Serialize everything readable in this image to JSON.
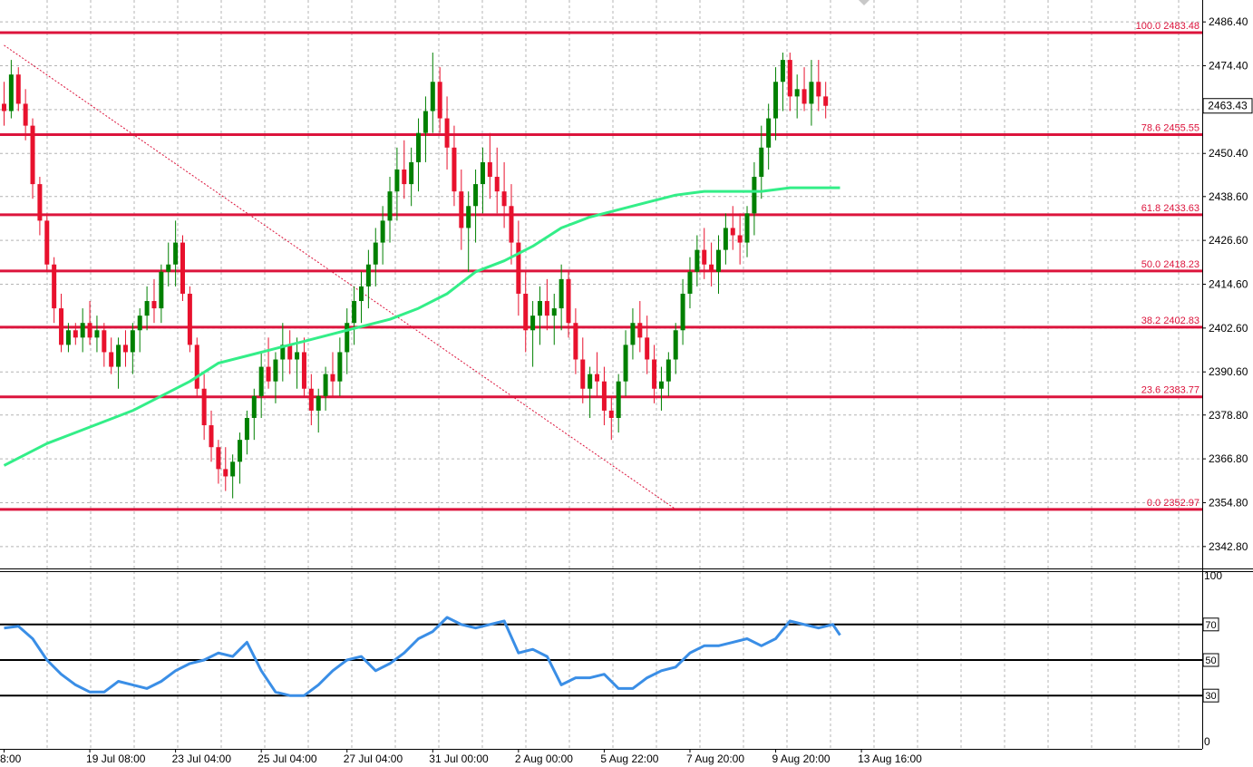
{
  "chart_data": [
    {
      "type": "candlestick",
      "panel": "price",
      "ylim": [
        2336.8,
        2492.4
      ],
      "y_ticks": [
        "2486.40",
        "2474.40",
        "2462.40",
        "2450.40",
        "2438.60",
        "2426.60",
        "2414.60",
        "2402.60",
        "2390.60",
        "2378.80",
        "2366.80",
        "2354.80",
        "2342.80"
      ],
      "y_tick_values": [
        2486.4,
        2474.4,
        2462.4,
        2450.4,
        2438.6,
        2426.6,
        2414.6,
        2402.6,
        2390.6,
        2378.8,
        2366.8,
        2354.8,
        2342.8
      ],
      "x_ticks": [
        "8:00",
        "19 Jul 08:00",
        "23 Jul 04:00",
        "25 Jul 04:00",
        "27 Jul 04:00",
        "31 Jul 00:00",
        "2 Aug 00:00",
        "5 Aug 22:00",
        "7 Aug 20:00",
        "9 Aug 20:00",
        "13 Aug 16:00"
      ],
      "x_tick_index": [
        0,
        12,
        24,
        36,
        48,
        60,
        72,
        84,
        96,
        108,
        120
      ],
      "current_price": "2463.43",
      "current_value": 2463.43,
      "colors": {
        "bull": "#008000",
        "bear": "#e8112d",
        "ma": "#33ee88",
        "fib": "#dc143c",
        "grid": "#b4b4b4"
      },
      "fib_levels": [
        {
          "label": "100.0 2483.48",
          "value": 2483.48
        },
        {
          "label": "78.6 2455.55",
          "value": 2455.55
        },
        {
          "label": "61.8 2433.63",
          "value": 2433.63
        },
        {
          "label": "50.0 2418.23",
          "value": 2418.23
        },
        {
          "label": "38.2 2402.83",
          "value": 2402.83
        },
        {
          "label": "23.6 2383.77",
          "value": 2383.77
        },
        {
          "label": "0.0 2352.97",
          "value": 2352.97
        }
      ],
      "trendline": [
        {
          "i": 0,
          "v": 2480.0
        },
        {
          "i": 94,
          "v": 2353.0
        }
      ],
      "ma_points": [
        [
          0,
          2365
        ],
        [
          3,
          2368
        ],
        [
          6,
          2371
        ],
        [
          10,
          2374
        ],
        [
          14,
          2377
        ],
        [
          18,
          2380
        ],
        [
          22,
          2384
        ],
        [
          26,
          2388
        ],
        [
          30,
          2393
        ],
        [
          34,
          2395
        ],
        [
          38,
          2397
        ],
        [
          42,
          2399
        ],
        [
          46,
          2401
        ],
        [
          50,
          2403
        ],
        [
          54,
          2405
        ],
        [
          58,
          2408
        ],
        [
          62,
          2412
        ],
        [
          66,
          2418
        ],
        [
          70,
          2421
        ],
        [
          74,
          2425
        ],
        [
          78,
          2430
        ],
        [
          82,
          2433
        ],
        [
          86,
          2435
        ],
        [
          90,
          2437
        ],
        [
          94,
          2439
        ],
        [
          98,
          2440
        ],
        [
          102,
          2440
        ],
        [
          106,
          2440
        ],
        [
          110,
          2441
        ],
        [
          114,
          2441
        ],
        [
          117,
          2441
        ]
      ],
      "candles": [
        [
          2464,
          2470,
          2458,
          2462
        ],
        [
          2462,
          2476,
          2460,
          2472
        ],
        [
          2472,
          2474,
          2462,
          2464
        ],
        [
          2464,
          2468,
          2454,
          2458
        ],
        [
          2458,
          2460,
          2438,
          2442
        ],
        [
          2442,
          2444,
          2428,
          2432
        ],
        [
          2432,
          2434,
          2418,
          2420
        ],
        [
          2420,
          2422,
          2404,
          2408
        ],
        [
          2408,
          2412,
          2396,
          2398
        ],
        [
          2398,
          2404,
          2396,
          2402
        ],
        [
          2402,
          2404,
          2398,
          2400
        ],
        [
          2400,
          2408,
          2396,
          2404
        ],
        [
          2404,
          2410,
          2398,
          2400
        ],
        [
          2400,
          2406,
          2396,
          2402
        ],
        [
          2402,
          2404,
          2392,
          2396
        ],
        [
          2396,
          2400,
          2390,
          2392
        ],
        [
          2392,
          2400,
          2386,
          2398
        ],
        [
          2398,
          2402,
          2392,
          2396
        ],
        [
          2396,
          2404,
          2390,
          2402
        ],
        [
          2402,
          2408,
          2396,
          2406
        ],
        [
          2406,
          2414,
          2402,
          2410
        ],
        [
          2410,
          2416,
          2404,
          2408
        ],
        [
          2408,
          2420,
          2404,
          2418
        ],
        [
          2418,
          2426,
          2414,
          2420
        ],
        [
          2420,
          2432,
          2414,
          2426
        ],
        [
          2426,
          2428,
          2410,
          2412
        ],
        [
          2412,
          2414,
          2396,
          2398
        ],
        [
          2398,
          2400,
          2384,
          2386
        ],
        [
          2386,
          2390,
          2372,
          2376
        ],
        [
          2376,
          2380,
          2366,
          2370
        ],
        [
          2370,
          2372,
          2360,
          2364
        ],
        [
          2364,
          2370,
          2358,
          2362
        ],
        [
          2362,
          2368,
          2356,
          2366
        ],
        [
          2366,
          2374,
          2360,
          2372
        ],
        [
          2372,
          2380,
          2368,
          2378
        ],
        [
          2378,
          2386,
          2372,
          2384
        ],
        [
          2384,
          2396,
          2378,
          2392
        ],
        [
          2392,
          2400,
          2386,
          2388
        ],
        [
          2388,
          2396,
          2382,
          2394
        ],
        [
          2394,
          2404,
          2388,
          2398
        ],
        [
          2398,
          2402,
          2390,
          2394
        ],
        [
          2394,
          2400,
          2386,
          2396
        ],
        [
          2396,
          2400,
          2384,
          2386
        ],
        [
          2386,
          2390,
          2376,
          2380
        ],
        [
          2380,
          2386,
          2374,
          2384
        ],
        [
          2384,
          2392,
          2380,
          2390
        ],
        [
          2390,
          2396,
          2384,
          2388
        ],
        [
          2388,
          2400,
          2384,
          2396
        ],
        [
          2396,
          2408,
          2390,
          2404
        ],
        [
          2404,
          2414,
          2398,
          2410
        ],
        [
          2410,
          2418,
          2404,
          2414
        ],
        [
          2414,
          2424,
          2408,
          2420
        ],
        [
          2420,
          2430,
          2414,
          2426
        ],
        [
          2426,
          2436,
          2420,
          2432
        ],
        [
          2432,
          2444,
          2426,
          2440
        ],
        [
          2440,
          2452,
          2432,
          2446
        ],
        [
          2446,
          2454,
          2438,
          2442
        ],
        [
          2442,
          2452,
          2436,
          2448
        ],
        [
          2448,
          2460,
          2440,
          2456
        ],
        [
          2456,
          2466,
          2448,
          2462
        ],
        [
          2462,
          2478,
          2456,
          2470
        ],
        [
          2470,
          2474,
          2456,
          2460
        ],
        [
          2460,
          2466,
          2446,
          2452
        ],
        [
          2452,
          2458,
          2436,
          2440
        ],
        [
          2440,
          2446,
          2424,
          2430
        ],
        [
          2430,
          2440,
          2418,
          2436
        ],
        [
          2436,
          2446,
          2426,
          2442
        ],
        [
          2442,
          2452,
          2434,
          2448
        ],
        [
          2448,
          2456,
          2438,
          2444
        ],
        [
          2444,
          2452,
          2434,
          2440
        ],
        [
          2440,
          2448,
          2430,
          2436
        ],
        [
          2436,
          2442,
          2420,
          2426
        ],
        [
          2426,
          2432,
          2406,
          2412
        ],
        [
          2412,
          2418,
          2396,
          2402
        ],
        [
          2402,
          2410,
          2392,
          2406
        ],
        [
          2406,
          2414,
          2398,
          2410
        ],
        [
          2410,
          2416,
          2402,
          2406
        ],
        [
          2406,
          2412,
          2398,
          2408
        ],
        [
          2408,
          2420,
          2402,
          2416
        ],
        [
          2416,
          2418,
          2400,
          2404
        ],
        [
          2404,
          2408,
          2390,
          2394
        ],
        [
          2394,
          2400,
          2382,
          2386
        ],
        [
          2386,
          2392,
          2378,
          2390
        ],
        [
          2390,
          2396,
          2384,
          2388
        ],
        [
          2388,
          2392,
          2376,
          2380
        ],
        [
          2380,
          2384,
          2372,
          2378
        ],
        [
          2378,
          2390,
          2374,
          2388
        ],
        [
          2388,
          2402,
          2384,
          2398
        ],
        [
          2398,
          2408,
          2394,
          2404
        ],
        [
          2404,
          2410,
          2396,
          2400
        ],
        [
          2400,
          2406,
          2390,
          2394
        ],
        [
          2394,
          2398,
          2382,
          2386
        ],
        [
          2386,
          2392,
          2380,
          2388
        ],
        [
          2388,
          2396,
          2384,
          2394
        ],
        [
          2394,
          2404,
          2390,
          2402
        ],
        [
          2402,
          2416,
          2398,
          2412
        ],
        [
          2412,
          2422,
          2408,
          2418
        ],
        [
          2418,
          2428,
          2414,
          2424
        ],
        [
          2424,
          2430,
          2416,
          2420
        ],
        [
          2420,
          2426,
          2414,
          2418
        ],
        [
          2418,
          2428,
          2412,
          2424
        ],
        [
          2424,
          2434,
          2420,
          2430
        ],
        [
          2430,
          2436,
          2424,
          2428
        ],
        [
          2428,
          2434,
          2420,
          2426
        ],
        [
          2426,
          2436,
          2422,
          2434
        ],
        [
          2434,
          2448,
          2428,
          2444
        ],
        [
          2444,
          2458,
          2438,
          2452
        ],
        [
          2452,
          2464,
          2446,
          2460
        ],
        [
          2460,
          2474,
          2454,
          2470
        ],
        [
          2470,
          2478,
          2462,
          2476
        ],
        [
          2476,
          2478,
          2462,
          2466
        ],
        [
          2466,
          2472,
          2460,
          2468
        ],
        [
          2468,
          2474,
          2462,
          2464
        ],
        [
          2464,
          2476,
          2458,
          2470
        ],
        [
          2470,
          2476,
          2462,
          2466
        ],
        [
          2466,
          2470,
          2460,
          2463.43
        ]
      ]
    },
    {
      "type": "line",
      "panel": "rsi",
      "ylim": [
        0,
        100
      ],
      "y_ticks": [
        "100",
        "0"
      ],
      "levels": [
        {
          "label": "70",
          "value": 70
        },
        {
          "label": "50",
          "value": 50
        },
        {
          "label": "30",
          "value": 30
        }
      ],
      "colors": {
        "line": "#3a8ee6",
        "level": "#000000"
      },
      "points": [
        [
          0,
          68
        ],
        [
          2,
          69
        ],
        [
          4,
          62
        ],
        [
          6,
          50
        ],
        [
          8,
          42
        ],
        [
          10,
          36
        ],
        [
          12,
          32
        ],
        [
          14,
          32
        ],
        [
          16,
          38
        ],
        [
          18,
          36
        ],
        [
          20,
          34
        ],
        [
          22,
          38
        ],
        [
          24,
          44
        ],
        [
          26,
          48
        ],
        [
          28,
          50
        ],
        [
          30,
          54
        ],
        [
          32,
          52
        ],
        [
          34,
          60
        ],
        [
          36,
          44
        ],
        [
          38,
          32
        ],
        [
          40,
          30
        ],
        [
          42,
          30
        ],
        [
          44,
          36
        ],
        [
          46,
          44
        ],
        [
          48,
          50
        ],
        [
          50,
          52
        ],
        [
          52,
          44
        ],
        [
          54,
          48
        ],
        [
          56,
          54
        ],
        [
          58,
          62
        ],
        [
          60,
          66
        ],
        [
          62,
          74
        ],
        [
          64,
          70
        ],
        [
          66,
          68
        ],
        [
          68,
          70
        ],
        [
          70,
          72
        ],
        [
          72,
          54
        ],
        [
          74,
          56
        ],
        [
          76,
          52
        ],
        [
          78,
          36
        ],
        [
          80,
          40
        ],
        [
          82,
          40
        ],
        [
          84,
          42
        ],
        [
          86,
          34
        ],
        [
          88,
          34
        ],
        [
          90,
          40
        ],
        [
          92,
          44
        ],
        [
          94,
          46
        ],
        [
          96,
          54
        ],
        [
          98,
          58
        ],
        [
          100,
          58
        ],
        [
          102,
          60
        ],
        [
          104,
          62
        ],
        [
          106,
          58
        ],
        [
          108,
          62
        ],
        [
          110,
          72
        ],
        [
          112,
          70
        ],
        [
          114,
          68
        ],
        [
          116,
          70
        ],
        [
          117,
          64
        ]
      ]
    }
  ]
}
